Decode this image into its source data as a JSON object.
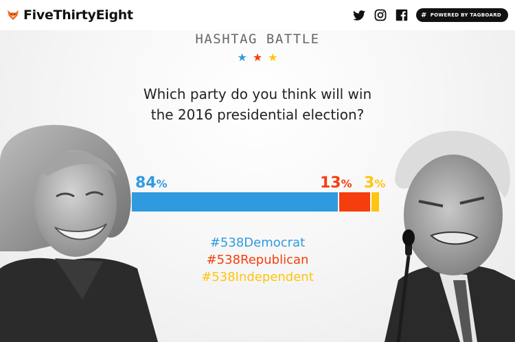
{
  "header": {
    "brand_name": "FiveThirtyEight",
    "social_icons": [
      "twitter-icon",
      "instagram-icon",
      "facebook-icon"
    ],
    "tagboard_label": "POWERED BY TAGBOARD",
    "tagboard_icon": "#"
  },
  "heading": "HASHTAG BATTLE",
  "stars": [
    {
      "glyph": "★",
      "color": "#2f9ae0"
    },
    {
      "glyph": "★",
      "color": "#f53d0d"
    },
    {
      "glyph": "★",
      "color": "#ffc40d"
    }
  ],
  "question": {
    "line1": "Which party do you think will win",
    "line2": "the 2016 presidential election?"
  },
  "results": [
    {
      "party": "democrat",
      "hashtag": "#538Democrat",
      "percent": 84,
      "percent_label": "84",
      "color": "#2f9ae0"
    },
    {
      "party": "republican",
      "hashtag": "#538Republican",
      "percent": 13,
      "percent_label": "13",
      "color": "#f53d0d"
    },
    {
      "party": "independent",
      "hashtag": "#538Independent",
      "percent": 3,
      "percent_label": "3",
      "color": "#ffc40d"
    }
  ],
  "percent_sign": "%",
  "photos": {
    "left": "candidate-photo-left",
    "right": "candidate-photo-right"
  }
}
